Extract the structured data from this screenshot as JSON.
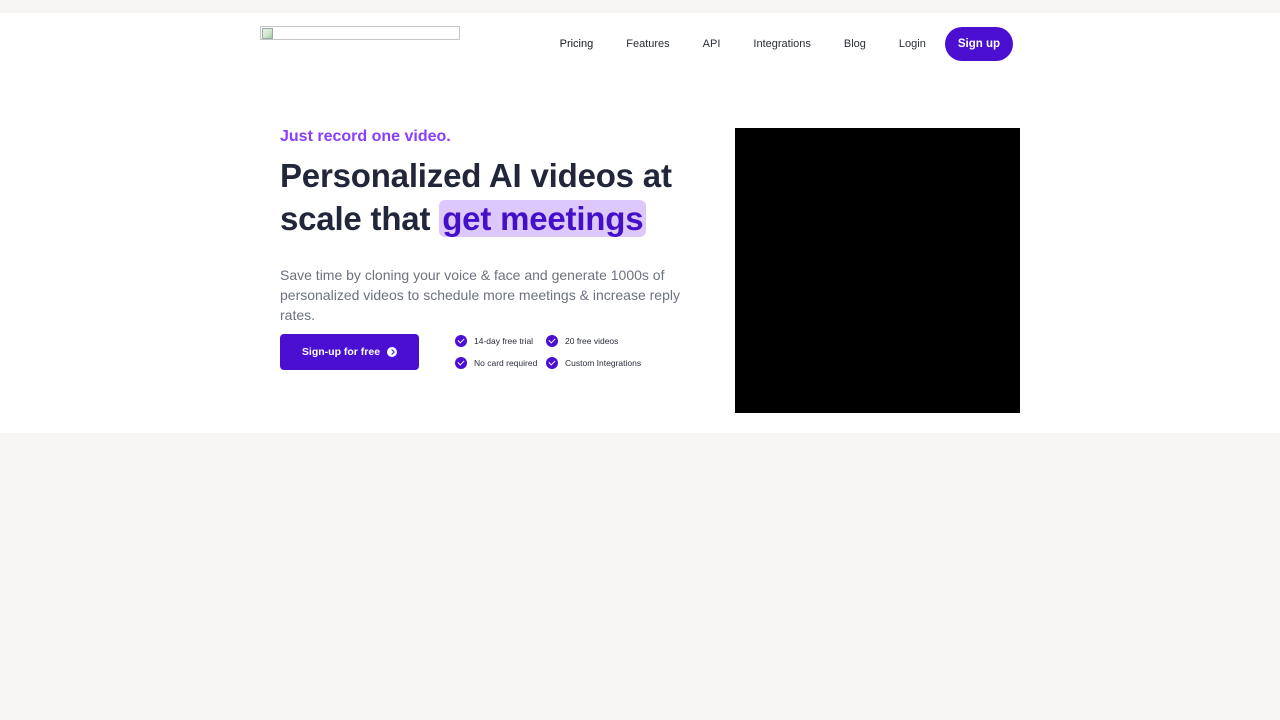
{
  "nav": {
    "items": [
      "Pricing",
      "Features",
      "API",
      "Integrations",
      "Blog",
      "Login"
    ],
    "signup_label": "Sign up"
  },
  "hero": {
    "eyebrow": "Just record one video.",
    "headline_line1": "Personalized AI videos at",
    "headline_line2_prefix": "scale that ",
    "headline_highlight": "get meetings",
    "subtext": "Save time by cloning your voice & face and generate 1000s of personalized videos to schedule more meetings & increase reply rates.",
    "cta_label": "Sign-up for free",
    "features": [
      "14-day free trial",
      "20 free videos",
      "No card required",
      "Custom Integrations"
    ]
  },
  "colors": {
    "accent": "#4a0fd0",
    "eyebrow": "#8a3dfa",
    "highlight_bg": "#dcc8fb",
    "page_bg": "#f7f6f4"
  },
  "icons": [
    "logo-image",
    "arrow-right-circle-icon",
    "check-circle-icon"
  ]
}
